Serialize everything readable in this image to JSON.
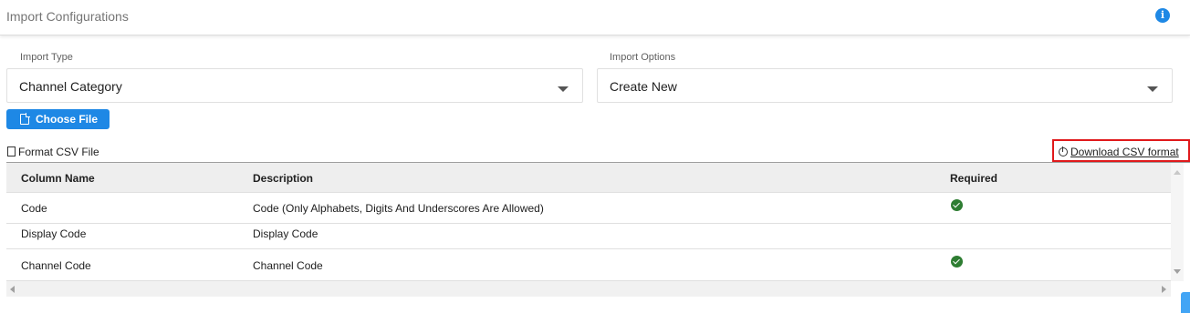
{
  "header": {
    "title": "Import Configurations",
    "info_glyph": "i"
  },
  "import_type": {
    "label": "Import Type",
    "value": "Channel Category"
  },
  "import_options": {
    "label": "Import Options",
    "value": "Create New"
  },
  "choose_file": {
    "label": "Choose File"
  },
  "format": {
    "label": "Format CSV File",
    "download_label": "Download CSV format"
  },
  "table": {
    "headers": {
      "column_name": "Column Name",
      "description": "Description",
      "required": "Required"
    },
    "rows": [
      {
        "column_name": "Code",
        "description": "Code (Only Alphabets, Digits And Underscores Are Allowed)",
        "required": true
      },
      {
        "column_name": "Display Code",
        "description": "Display Code",
        "required": false
      },
      {
        "column_name": "Channel Code",
        "description": "Channel Code",
        "required": true
      }
    ]
  },
  "colors": {
    "accent": "#1e88e5",
    "required_check": "#2e7d32",
    "highlight_border": "#e0191b"
  }
}
